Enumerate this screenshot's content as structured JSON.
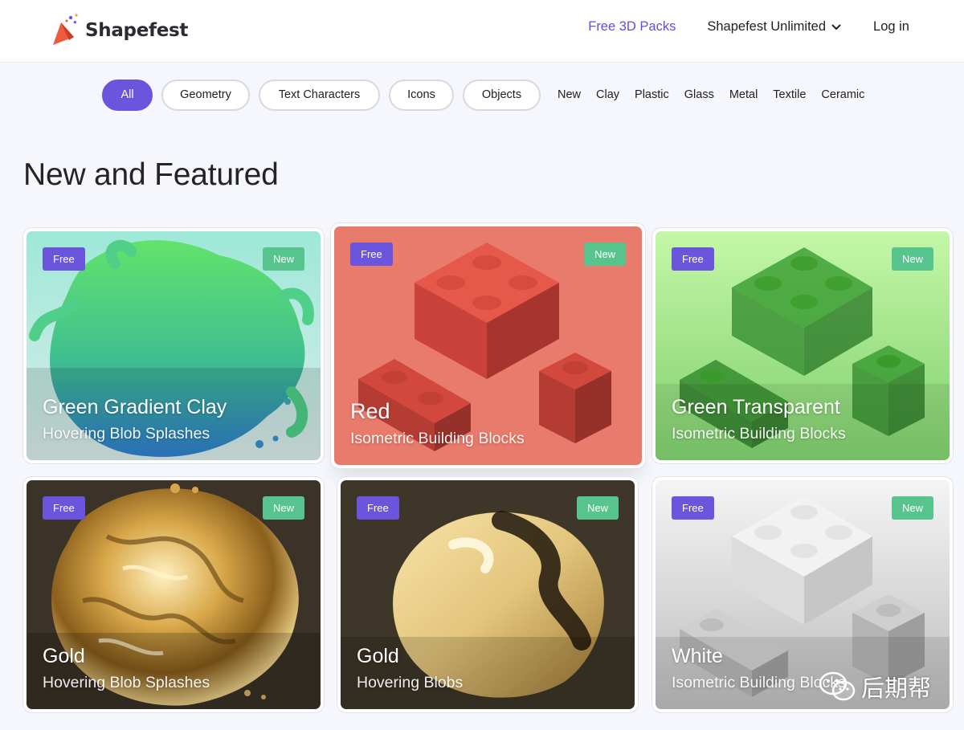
{
  "brand": {
    "name": "Shapefest"
  },
  "nav": {
    "free_packs": "Free 3D Packs",
    "unlimited": "Shapefest Unlimited",
    "login": "Log in"
  },
  "filters": {
    "pills": [
      "All",
      "Geometry",
      "Text Characters",
      "Icons",
      "Objects"
    ],
    "active": "All",
    "tags": [
      "New",
      "Clay",
      "Plastic",
      "Glass",
      "Metal",
      "Textile",
      "Ceramic"
    ]
  },
  "section": {
    "title": "New and Featured"
  },
  "badges": {
    "free": "Free",
    "new": "New"
  },
  "cards": [
    {
      "title": "Green Gradient Clay",
      "subtitle": "Hovering Blob Splashes"
    },
    {
      "title": "Red",
      "subtitle": "Isometric Building Blocks"
    },
    {
      "title": "Green Transparent",
      "subtitle": "Isometric Building Blocks"
    },
    {
      "title": "Gold",
      "subtitle": "Hovering Blob Splashes"
    },
    {
      "title": "Gold",
      "subtitle": "Hovering Blobs"
    },
    {
      "title": "White",
      "subtitle": "Isometric Building Blocks"
    }
  ],
  "watermark": {
    "text": "后期帮"
  },
  "colors": {
    "accent": "#6a55dc",
    "new_badge": "#58c48d",
    "nav_link_active": "#6150d6"
  }
}
